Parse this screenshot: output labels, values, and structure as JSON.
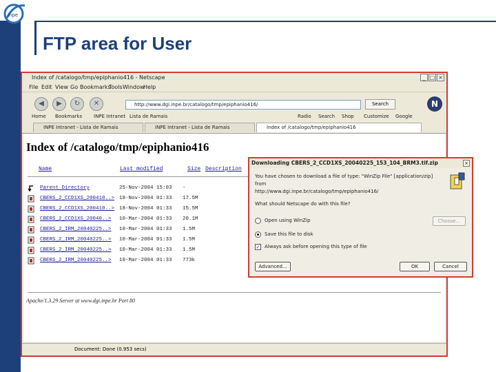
{
  "slide": {
    "title": "FTP area for User"
  },
  "browser": {
    "window_title": "Index of /catalogo/tmp/epiphanio416 - Netscape",
    "menu": [
      "File",
      "Edit",
      "View",
      "Go",
      "Bookmarks",
      "Tools",
      "Window",
      "Help"
    ],
    "url": "http://www.dgi.inpe.br/catalogo/tmp/epiphanio416/",
    "search_label": "Search",
    "bookmarks": [
      "Home",
      "Bookmarks",
      "INPE Intranet",
      "Lista de Ramais",
      "Radio",
      "Search",
      "Shop",
      "Customize",
      "Google"
    ],
    "tabs": [
      "INPE Intranet - Lista de Ramais",
      "INPE Intranet - Lista de Ramais",
      "Index of /catalogo/tmp/epiphanio416"
    ],
    "status": "Document: Done (0.953 secs)"
  },
  "listing": {
    "heading": "Index of /catalogo/tmp/epiphanio416",
    "columns": [
      "Name",
      "Last modified",
      "Size",
      "Description"
    ],
    "rows": [
      {
        "name": "Parent Directory",
        "date": "25-Nov-2004 15:03",
        "size": "-"
      },
      {
        "name": "CBERS_2_CCD1XS_200410..>",
        "date": "18-Nov-2004 01:33",
        "size": "17.5M"
      },
      {
        "name": "CBERS_2_CCD1XS_200410..>",
        "date": "18-Nov-2004 01:33",
        "size": "15.5M"
      },
      {
        "name": "CBERS_2_CCD1XS_20040..>",
        "date": "10-Mar-2004 01:33",
        "size": "20.1M"
      },
      {
        "name": "CBERS_2_IRM_20040225..>",
        "date": "10-Mar-2004 01:33",
        "size": "1.5M"
      },
      {
        "name": "CBERS_2_IRM_20040225..>",
        "date": "10-Mar-2004 01:33",
        "size": "1.5M"
      },
      {
        "name": "CBERS_2_IRM_20040225..>",
        "date": "10-Mar-2004 01:33",
        "size": "1.5M"
      },
      {
        "name": "CBERS_2_IRM_20040225..>",
        "date": "10-Mar-2004 01:33",
        "size": "773k"
      }
    ],
    "footer": "Apache/1.3.29 Server at www.dgi.inpe.br Port 80"
  },
  "dialog": {
    "title": "Downloading CBERS_2_CCD1XS_20040225_153_104_BRM3.tif.zip",
    "line1": "You have chosen to download a file of type: \"WinZip File\" [application/zip]",
    "line2": "from",
    "line3": "http://www.dgi.inpe.br/catalogo/tmp/epiphanio416/",
    "question": "What should Netscape do with this file?",
    "option_open": "Open using WinZip",
    "option_save": "Save this file to disk",
    "choose_label": "Choose...",
    "always_ask": "Always ask before opening this type of file",
    "advanced_label": "Advanced...",
    "ok_label": "OK",
    "cancel_label": "Cancel"
  },
  "colors": {
    "slide_accent": "#1d3f7a",
    "highlight_border": "#d23a32",
    "link": "#1a1a9e"
  }
}
